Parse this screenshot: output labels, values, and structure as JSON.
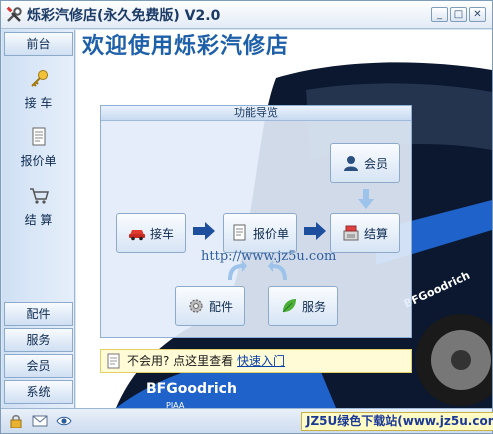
{
  "window": {
    "title": "烁彩汽修店(永久免费版) V2.0",
    "controls": {
      "minimize": "_",
      "maximize": "□",
      "close": "✕"
    }
  },
  "sidebar": {
    "top_tab": "前台",
    "items": [
      {
        "label": "接 车",
        "icon": "key-icon"
      },
      {
        "label": "报价单",
        "icon": "document-icon"
      },
      {
        "label": "结 算",
        "icon": "cart-icon"
      }
    ],
    "bottom_tabs": [
      "配件",
      "服务",
      "会员",
      "系统"
    ]
  },
  "main": {
    "welcome": "欢迎使用烁彩汽修店",
    "panel_title": "功能导览",
    "buttons": {
      "receive": "接车",
      "quote": "报价单",
      "settle": "结算",
      "member": "会员",
      "parts": "配件",
      "service": "服务"
    },
    "watermark": "http://www.jz5u.com",
    "hint_text": "不会用? 点这里查看",
    "hint_link": "快速入门"
  },
  "statusbar": {
    "icons": [
      "lock-icon",
      "mail-icon",
      "eye-icon"
    ],
    "site_badge": "JZ5U绿色下载站(www.jz5u.com)"
  },
  "colors": {
    "accent": "#1d5fa8",
    "panel_bg": "#e2ecf8",
    "hint_bg": "#fffbd6",
    "car_body": "#0b1830"
  }
}
